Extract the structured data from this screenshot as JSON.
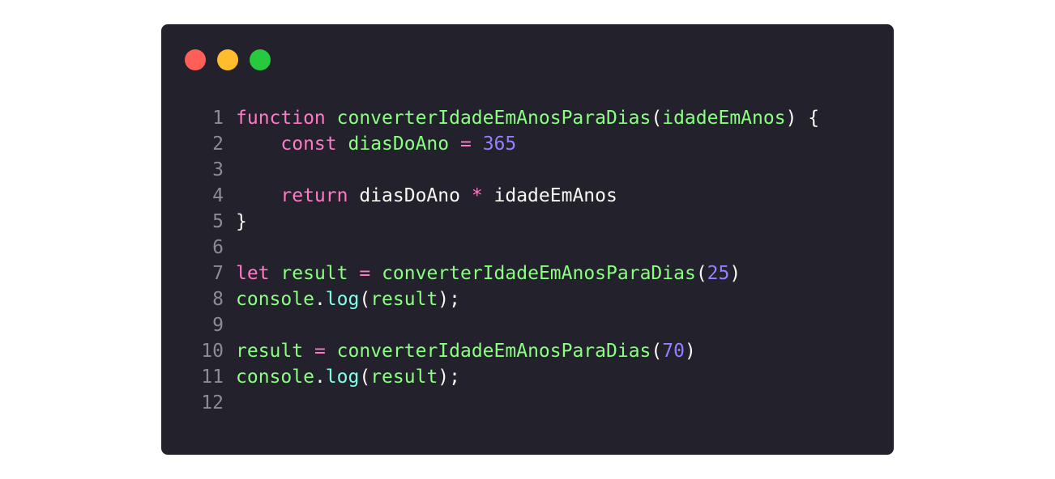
{
  "window": {
    "controls": [
      {
        "name": "close-button",
        "color": "#ff5f56"
      },
      {
        "name": "minimize-button",
        "color": "#ffbd2e"
      },
      {
        "name": "maximize-button",
        "color": "#27c93f"
      }
    ]
  },
  "code": {
    "lines": [
      {
        "n": "1",
        "tokens": [
          {
            "t": "function",
            "k": "keyword"
          },
          {
            "t": " ",
            "k": "space"
          },
          {
            "t": "converterIdadeEmAnosParaDias",
            "k": "function"
          },
          {
            "t": "(",
            "k": "punct"
          },
          {
            "t": "idadeEmAnos",
            "k": "param"
          },
          {
            "t": ") {",
            "k": "punct"
          }
        ]
      },
      {
        "n": "2",
        "tokens": [
          {
            "t": "    ",
            "k": "space"
          },
          {
            "t": "const",
            "k": "keyword"
          },
          {
            "t": " ",
            "k": "space"
          },
          {
            "t": "diasDoAno",
            "k": "variable"
          },
          {
            "t": " ",
            "k": "space"
          },
          {
            "t": "=",
            "k": "operator"
          },
          {
            "t": " ",
            "k": "space"
          },
          {
            "t": "365",
            "k": "number"
          }
        ]
      },
      {
        "n": "3",
        "tokens": []
      },
      {
        "n": "4",
        "tokens": [
          {
            "t": "    ",
            "k": "space"
          },
          {
            "t": "return",
            "k": "keyword"
          },
          {
            "t": " diasDoAno ",
            "k": "ident"
          },
          {
            "t": "*",
            "k": "operator"
          },
          {
            "t": " idadeEmAnos",
            "k": "ident"
          }
        ]
      },
      {
        "n": "5",
        "tokens": [
          {
            "t": "}",
            "k": "punct"
          }
        ]
      },
      {
        "n": "6",
        "tokens": []
      },
      {
        "n": "7",
        "tokens": [
          {
            "t": "let",
            "k": "keyword"
          },
          {
            "t": " ",
            "k": "space"
          },
          {
            "t": "result",
            "k": "variable"
          },
          {
            "t": " ",
            "k": "space"
          },
          {
            "t": "=",
            "k": "operator"
          },
          {
            "t": " ",
            "k": "space"
          },
          {
            "t": "converterIdadeEmAnosParaDias",
            "k": "function"
          },
          {
            "t": "(",
            "k": "punct"
          },
          {
            "t": "25",
            "k": "number"
          },
          {
            "t": ")",
            "k": "punct"
          }
        ]
      },
      {
        "n": "8",
        "tokens": [
          {
            "t": "console",
            "k": "variable"
          },
          {
            "t": ".",
            "k": "punct"
          },
          {
            "t": "log",
            "k": "method"
          },
          {
            "t": "(",
            "k": "punct"
          },
          {
            "t": "result",
            "k": "variable"
          },
          {
            "t": ");",
            "k": "punct"
          }
        ]
      },
      {
        "n": "9",
        "tokens": []
      },
      {
        "n": "10",
        "tokens": [
          {
            "t": "result",
            "k": "variable"
          },
          {
            "t": " ",
            "k": "space"
          },
          {
            "t": "=",
            "k": "operator"
          },
          {
            "t": " ",
            "k": "space"
          },
          {
            "t": "converterIdadeEmAnosParaDias",
            "k": "function"
          },
          {
            "t": "(",
            "k": "punct"
          },
          {
            "t": "70",
            "k": "number"
          },
          {
            "t": ")",
            "k": "punct"
          }
        ]
      },
      {
        "n": "11",
        "tokens": [
          {
            "t": "console",
            "k": "variable"
          },
          {
            "t": ".",
            "k": "punct"
          },
          {
            "t": "log",
            "k": "method"
          },
          {
            "t": "(",
            "k": "punct"
          },
          {
            "t": "result",
            "k": "variable"
          },
          {
            "t": ");",
            "k": "punct"
          }
        ]
      },
      {
        "n": "12",
        "tokens": []
      }
    ]
  }
}
